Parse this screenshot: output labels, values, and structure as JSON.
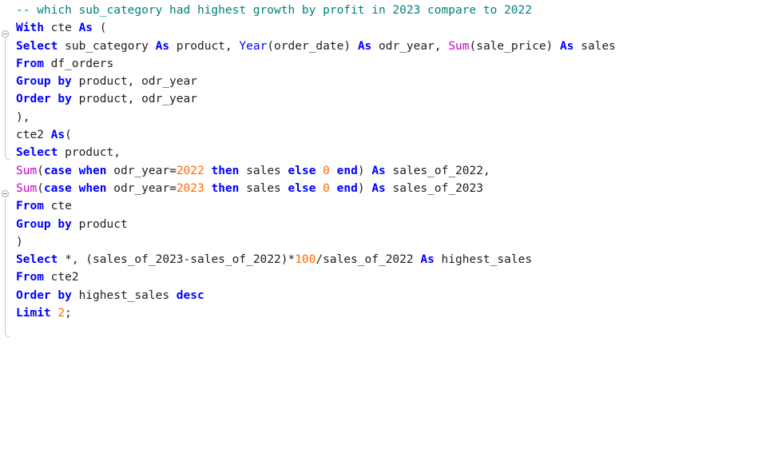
{
  "editor": {
    "lines": [
      [
        {
          "t": "-- which sub_category had highest growth by profit in 2023 compare to 2022",
          "c": "cmt"
        }
      ],
      [
        {
          "t": "With",
          "c": "kw"
        },
        {
          "t": " cte ",
          "c": "ident"
        },
        {
          "t": "As",
          "c": "kw"
        },
        {
          "t": " (",
          "c": "op"
        }
      ],
      [
        {
          "t": "Select",
          "c": "kw"
        },
        {
          "t": " sub_category ",
          "c": "ident"
        },
        {
          "t": "As",
          "c": "kw"
        },
        {
          "t": " product, ",
          "c": "ident"
        },
        {
          "t": "Year",
          "c": "fn"
        },
        {
          "t": "(order_date) ",
          "c": "ident"
        },
        {
          "t": "As",
          "c": "kw"
        },
        {
          "t": " odr_year, ",
          "c": "ident"
        },
        {
          "t": "Sum",
          "c": "agg"
        },
        {
          "t": "(sale_price) ",
          "c": "ident"
        },
        {
          "t": "As",
          "c": "kw"
        },
        {
          "t": " sales",
          "c": "ident"
        }
      ],
      [
        {
          "t": "From",
          "c": "kw"
        },
        {
          "t": " df_orders",
          "c": "ident"
        }
      ],
      [
        {
          "t": "Group by",
          "c": "kw"
        },
        {
          "t": " product, odr_year",
          "c": "ident"
        }
      ],
      [
        {
          "t": "Order by",
          "c": "kw"
        },
        {
          "t": " product, odr_year",
          "c": "ident"
        }
      ],
      [
        {
          "t": "),",
          "c": "op"
        }
      ],
      [
        {
          "t": "cte2 ",
          "c": "ident"
        },
        {
          "t": "As",
          "c": "kw"
        },
        {
          "t": "(",
          "c": "op"
        }
      ],
      [
        {
          "t": "Select",
          "c": "kw"
        },
        {
          "t": " product,",
          "c": "ident"
        }
      ],
      [
        {
          "t": "Sum",
          "c": "agg"
        },
        {
          "t": "(",
          "c": "op"
        },
        {
          "t": "case when",
          "c": "kw"
        },
        {
          "t": " odr_year=",
          "c": "ident"
        },
        {
          "t": "2022",
          "c": "num"
        },
        {
          "t": " ",
          "c": "op"
        },
        {
          "t": "then",
          "c": "kw"
        },
        {
          "t": " sales ",
          "c": "ident"
        },
        {
          "t": "else",
          "c": "kw"
        },
        {
          "t": " ",
          "c": "op"
        },
        {
          "t": "0",
          "c": "num"
        },
        {
          "t": " ",
          "c": "op"
        },
        {
          "t": "end",
          "c": "kw"
        },
        {
          "t": ") ",
          "c": "op"
        },
        {
          "t": "As",
          "c": "kw"
        },
        {
          "t": " sales_of_2022,",
          "c": "ident"
        }
      ],
      [
        {
          "t": "Sum",
          "c": "agg"
        },
        {
          "t": "(",
          "c": "op"
        },
        {
          "t": "case when",
          "c": "kw"
        },
        {
          "t": " odr_year=",
          "c": "ident"
        },
        {
          "t": "2023",
          "c": "num"
        },
        {
          "t": " ",
          "c": "op"
        },
        {
          "t": "then",
          "c": "kw"
        },
        {
          "t": " sales ",
          "c": "ident"
        },
        {
          "t": "else",
          "c": "kw"
        },
        {
          "t": " ",
          "c": "op"
        },
        {
          "t": "0",
          "c": "num"
        },
        {
          "t": " ",
          "c": "op"
        },
        {
          "t": "end",
          "c": "kw"
        },
        {
          "t": ") ",
          "c": "op"
        },
        {
          "t": "As",
          "c": "kw"
        },
        {
          "t": " sales_of_2023",
          "c": "ident"
        }
      ],
      [
        {
          "t": "From",
          "c": "kw"
        },
        {
          "t": " cte",
          "c": "ident"
        }
      ],
      [
        {
          "t": "Group by",
          "c": "kw"
        },
        {
          "t": " product",
          "c": "ident"
        }
      ],
      [
        {
          "t": ")",
          "c": "op"
        }
      ],
      [
        {
          "t": "Select",
          "c": "kw"
        },
        {
          "t": " *, (sales_of_2023-sales_of_2022)*",
          "c": "ident"
        },
        {
          "t": "100",
          "c": "num"
        },
        {
          "t": "/sales_of_2022 ",
          "c": "ident"
        },
        {
          "t": "As",
          "c": "kw"
        },
        {
          "t": " highest_sales",
          "c": "ident"
        }
      ],
      [
        {
          "t": "From",
          "c": "kw"
        },
        {
          "t": " cte2",
          "c": "ident"
        }
      ],
      [
        {
          "t": "Order by",
          "c": "kw"
        },
        {
          "t": " highest_sales ",
          "c": "ident"
        },
        {
          "t": "desc",
          "c": "kw"
        }
      ],
      [
        {
          "t": "Limit",
          "c": "kw"
        },
        {
          "t": " ",
          "c": "op"
        },
        {
          "t": "2",
          "c": "num"
        },
        {
          "t": ";",
          "c": "op"
        }
      ]
    ]
  },
  "colors": {
    "keyword": "#0000ff",
    "function": "#0000ff",
    "aggregate": "#c800c8",
    "number": "#ff6a00",
    "comment": "#008080",
    "text": "#1e1e1e",
    "background": "#ffffff"
  }
}
